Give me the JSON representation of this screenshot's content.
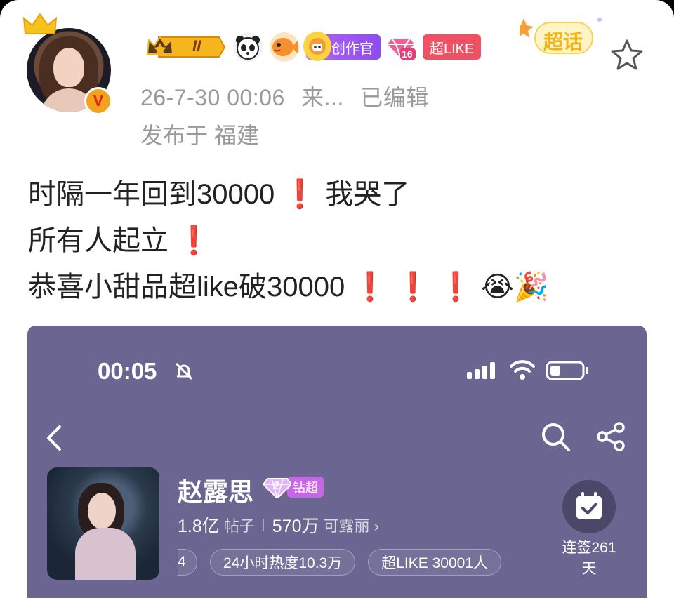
{
  "post": {
    "level_badge": "II",
    "creator_badge": "创作官",
    "gem_level": "16",
    "like_badge": "超LIKE",
    "chaohua_label": "超话",
    "verified_mark": "V",
    "timestamp": "26-7-30 00:06",
    "source": "来...",
    "edited": "已编辑",
    "location": "发布于 福建",
    "lines": [
      {
        "text": "时隔一年回到30000",
        "suffix": "❗",
        "tail": " 我哭了"
      },
      {
        "text": "所有人起立",
        "suffix": "❗",
        "tail": ""
      },
      {
        "text": "恭喜小甜品超like破30000",
        "suffix": "❗ ❗ ❗",
        "tail": " 😭🎉"
      }
    ]
  },
  "screenshot": {
    "status_time": "00:05",
    "name": "赵露思",
    "diamond_level": "2",
    "diamond_tag": "钻超",
    "posts_count": "1.8亿",
    "posts_label": "帖子",
    "fans_count": "570万",
    "fans_label": "可露丽 ›",
    "chip_cut": "4",
    "chip_heat": "24小时热度10.3万",
    "chip_like": "超LIKE 30001人",
    "checkin_line1": "连签261",
    "checkin_line2": "天"
  }
}
